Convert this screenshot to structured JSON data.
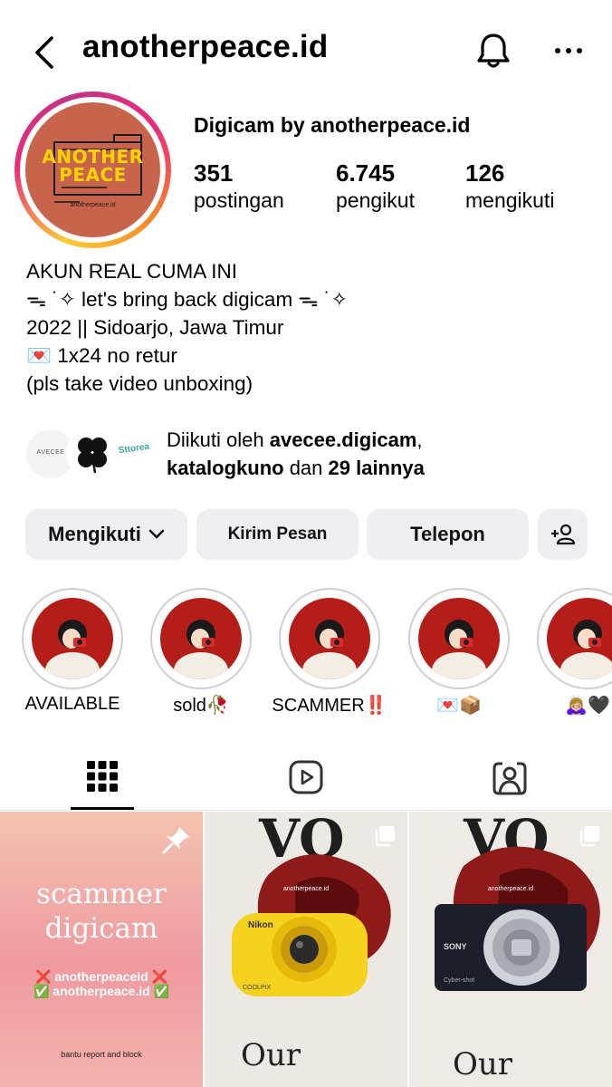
{
  "header": {
    "username": "anotherpeace.id",
    "icons": [
      "back-icon",
      "bell-icon",
      "more-icon"
    ]
  },
  "profile": {
    "display_name": "Digicam by anotherpeace.id",
    "avatar": {
      "logo_line1": "ANOTHER",
      "logo_line2": "PEACE",
      "small_text": "anotherpeace.id"
    },
    "stats": [
      {
        "value": "351",
        "label": "postingan"
      },
      {
        "value": "6.745",
        "label": "pengikut"
      },
      {
        "value": "126",
        "label": "mengikuti"
      }
    ]
  },
  "bio": {
    "lines": [
      "AKUN REAL CUMA INI",
      "ᯓ ˙✧ let's bring back digicam ᯓ ˙✧",
      "2022 || Sidoarjo, Jawa Timur",
      "💌 1x24 no retur",
      "(pls take video unboxing)"
    ]
  },
  "followed_by": {
    "prefix": "Diikuti oleh ",
    "user1": "avecee.digicam",
    "sep": ",",
    "user2": "katalogkuno",
    "middle": " dan ",
    "others": "29 lainnya",
    "avatar1_text": "AVECEE",
    "avatar3_text": "Sttorea"
  },
  "buttons": {
    "following": "Mengikuti",
    "message": "Kirim Pesan",
    "call": "Telepon"
  },
  "highlights": [
    {
      "label": "AVAILABLE"
    },
    {
      "label": "sold🥀"
    },
    {
      "label": "SCAMMER‼️"
    },
    {
      "label": "💌📦"
    },
    {
      "label": "🙇🏼‍♀️🖤"
    }
  ],
  "tabs": [
    "grid-tab",
    "reels-tab",
    "tagged-tab"
  ],
  "posts": [
    {
      "title_line1": "scammer",
      "title_line2": "digicam",
      "line1": "❌ anotherpeaceid ❌",
      "line2": "✅ anotherpeace.id ✅",
      "footer": "bantu report and block"
    },
    {
      "watermark": "anotherpeace.id",
      "camera_brand": "Nikon",
      "camera_model": "COOLPIX"
    },
    {
      "watermark": "anotherpeace.id",
      "camera_brand": "SONY",
      "camera_model": "Cyber-shot"
    }
  ],
  "colors": {
    "button_bg": "#efeff3",
    "avatar_bg": "#c8634c",
    "highlight_bg": "#b51d19"
  }
}
